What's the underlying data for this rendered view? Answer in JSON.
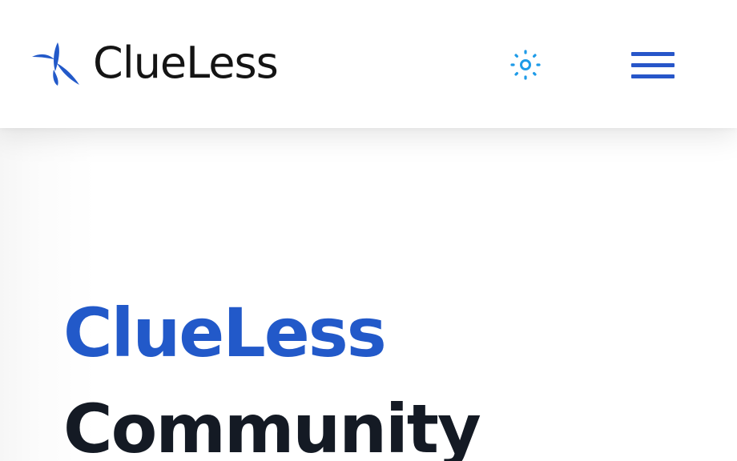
{
  "header": {
    "brand_name": "ClueLess",
    "logo_icon": "clueless-logo-icon",
    "theme_toggle_icon": "sun-icon",
    "menu_icon": "hamburger-menu-icon"
  },
  "hero": {
    "title_accent": "ClueLess",
    "title_rest": "Community"
  },
  "colors": {
    "brand_blue": "#2259c9",
    "icon_light_blue": "#1e9be8",
    "text_dark": "#141a24",
    "brand_text": "#141414"
  }
}
